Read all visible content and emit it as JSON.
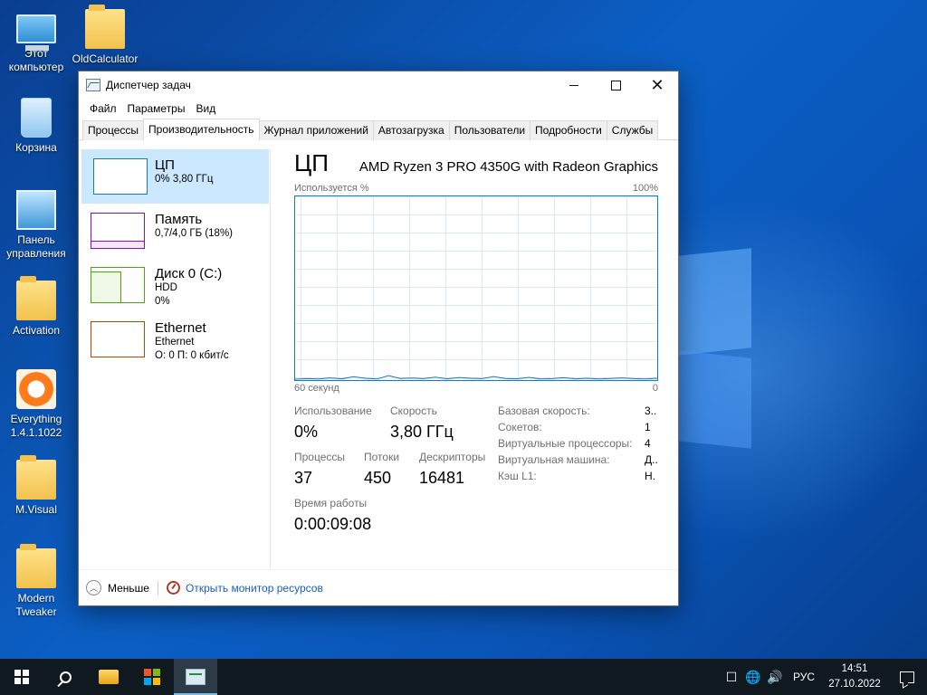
{
  "desktop": {
    "icons": [
      {
        "label_line1": "Этот",
        "label_line2": "компьютер"
      },
      {
        "label_line1": "OldCalculator",
        "label_line2": ""
      },
      {
        "label_line1": "Корзина",
        "label_line2": ""
      },
      {
        "label_line1": "Панель",
        "label_line2": "управления"
      },
      {
        "label_line1": "Activation",
        "label_line2": ""
      },
      {
        "label_line1": "Everything",
        "label_line2": "1.4.1.1022"
      },
      {
        "label_line1": "M.Visual",
        "label_line2": ""
      },
      {
        "label_line1": "Modern",
        "label_line2": "Tweaker"
      }
    ]
  },
  "window": {
    "title": "Диспетчер задач",
    "icon": "task-manager-icon",
    "controls": {
      "minimize": "minimize",
      "maximize": "maximize",
      "close": "✕"
    }
  },
  "menu": [
    "Файл",
    "Параметры",
    "Вид"
  ],
  "tabs": [
    {
      "label": "Процессы",
      "active": false
    },
    {
      "label": "Производительность",
      "active": true
    },
    {
      "label": "Журнал приложений",
      "active": false
    },
    {
      "label": "Автозагрузка",
      "active": false
    },
    {
      "label": "Пользователи",
      "active": false
    },
    {
      "label": "Подробности",
      "active": false
    },
    {
      "label": "Службы",
      "active": false
    }
  ],
  "sidebar": [
    {
      "name": "ЦП",
      "line1": "0% 3,80 ГГц",
      "line2": "",
      "color": "#117dbb"
    },
    {
      "name": "Память",
      "line1": "0,7/4,0 ГБ (18%)",
      "line2": "",
      "color": "#8b12ae"
    },
    {
      "name": "Диск 0 (C:)",
      "line1": "HDD",
      "line2": "0%",
      "color": "#4da60c"
    },
    {
      "name": "Ethernet",
      "line1": "Ethernet",
      "line2": "О: 0 П: 0 кбит/с",
      "color": "#a74f01"
    }
  ],
  "cpu": {
    "heading": "ЦП",
    "model": "AMD Ryzen 3 PRO 4350G with Radeon Graphics",
    "graph_label": "Используется %",
    "graph_max": "100%",
    "graph_time": "60 секунд",
    "graph_min": "0",
    "usage_series_percent": [
      0.5,
      0.8,
      0.6,
      1.2,
      0.7,
      1.8,
      1.0,
      0.6,
      2.4,
      0.9,
      1.1,
      0.8,
      1.6,
      0.7,
      1.4,
      1.0,
      0.8,
      1.9,
      0.9,
      0.7,
      1.5,
      0.6,
      0.8,
      1.3,
      0.7,
      1.0,
      0.6,
      0.9,
      1.2,
      0.8,
      0.6,
      1.0
    ],
    "stats": {
      "usage_label": "Использование",
      "usage_value": "0%",
      "speed_label": "Скорость",
      "speed_value": "3,80 ГГц",
      "processes_label": "Процессы",
      "processes_value": "37",
      "threads_label": "Потоки",
      "threads_value": "450",
      "handles_label": "Дескрипторы",
      "handles_value": "16481",
      "uptime_label": "Время работы",
      "uptime_value": "0:00:09:08"
    },
    "specs": [
      {
        "key": "Базовая скорость:",
        "value": "3.."
      },
      {
        "key": "Сокетов:",
        "value": "1"
      },
      {
        "key": "Виртуальные процессоры:",
        "value": "4"
      },
      {
        "key": "Виртуальная машина:",
        "value": "Д.."
      },
      {
        "key": "Кэш L1:",
        "value": "Н."
      }
    ]
  },
  "footer": {
    "less_label": "Меньше",
    "monitor_link": "Открыть монитор ресурсов"
  },
  "taskbar": {
    "language": "РУС",
    "time": "14:51",
    "date": "27.10.2022"
  }
}
